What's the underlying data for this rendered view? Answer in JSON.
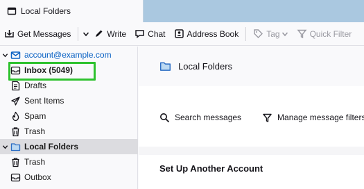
{
  "tab": {
    "label": "Local Folders",
    "icon": "folder-icon"
  },
  "toolbar": {
    "get_messages": "Get Messages",
    "write": "Write",
    "chat": "Chat",
    "address_book": "Address Book",
    "tag": "Tag",
    "quick_filter": "Quick Filter"
  },
  "sidebar": {
    "account": "account@example.com",
    "items": [
      {
        "label": "Inbox (5049)",
        "icon": "inbox-icon"
      },
      {
        "label": "Drafts",
        "icon": "drafts-icon"
      },
      {
        "label": "Sent Items",
        "icon": "sent-icon"
      },
      {
        "label": "Spam",
        "icon": "spam-icon"
      },
      {
        "label": "Trash",
        "icon": "trash-icon"
      }
    ],
    "local_folders": "Local Folders",
    "local_items": [
      {
        "label": "Trash",
        "icon": "trash-icon"
      },
      {
        "label": "Outbox",
        "icon": "outbox-icon"
      }
    ]
  },
  "main": {
    "title": "Local Folders",
    "search": "Search messages",
    "filters": "Manage message filters",
    "setup": "Set Up Another Account"
  },
  "colors": {
    "accent": "#0b62c4",
    "highlight": "#2ec22e",
    "tabstrip": "#aac8e0"
  }
}
